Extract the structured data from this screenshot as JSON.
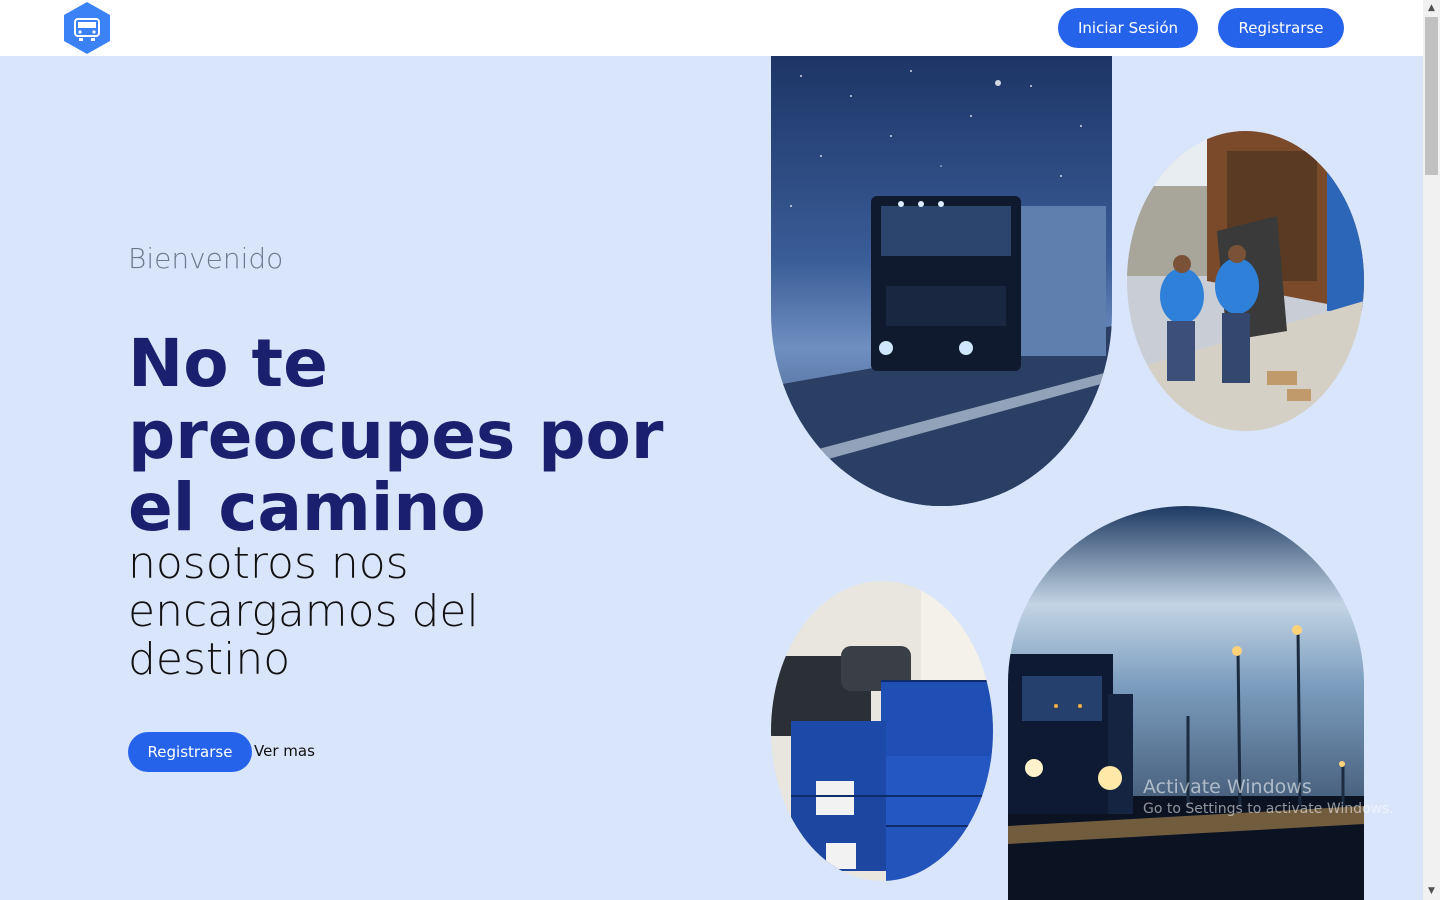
{
  "header": {
    "logo_icon": "hexagon-truck-logo",
    "login_label": "Iniciar Sesión",
    "register_label": "Registrarse"
  },
  "hero": {
    "welcome": "Bienvenido",
    "headline": "No te preocupes por el camino",
    "subheadline": "nosotros nos encargamos del destino",
    "cta_label": "Registrarse",
    "more_label": "Ver mas"
  },
  "watermark": {
    "title": "Activate Windows",
    "subtitle": "Go to Settings to activate Windows."
  },
  "colors": {
    "accent": "#2563eb",
    "background": "#d9e5fa",
    "headline": "#1a1f6e"
  }
}
